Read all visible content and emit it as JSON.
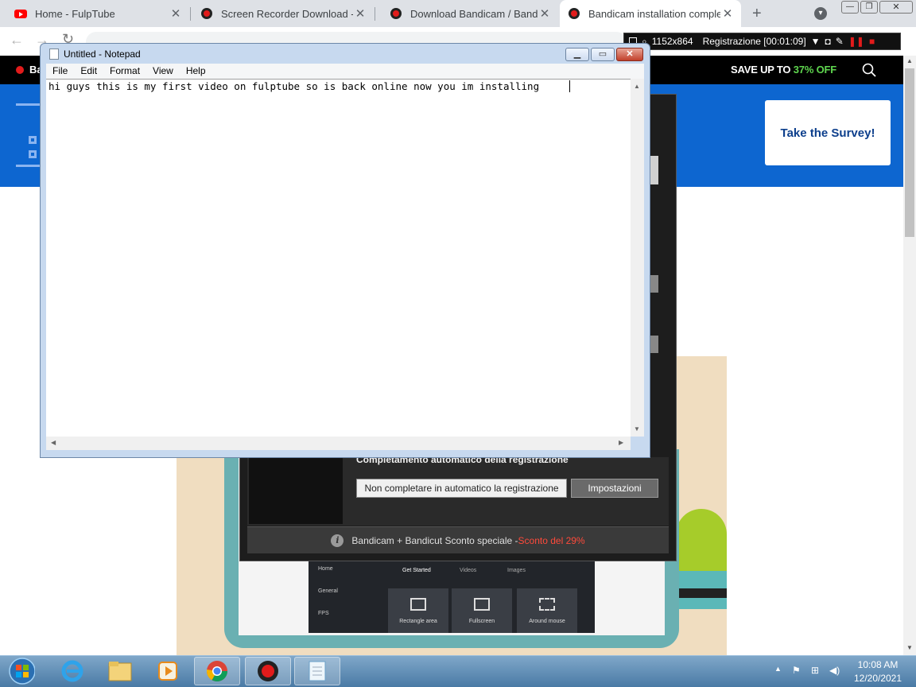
{
  "browser": {
    "tabs": [
      {
        "title": "Home - FulpTube",
        "favicon": "youtube-icon",
        "active": false
      },
      {
        "title": "Screen Recorder Download - Ba",
        "favicon": "bandicam-icon",
        "active": false
      },
      {
        "title": "Download Bandicam / Bandicut",
        "favicon": "bandicam-icon",
        "active": false
      },
      {
        "title": "Bandicam installation complete",
        "favicon": "bandicam-icon",
        "active": true
      }
    ],
    "new_tab_glyph": "+",
    "menu_glyph": "▾",
    "window_controls": {
      "minimize": "—",
      "restore": "❐",
      "close": "✕"
    }
  },
  "site": {
    "nav_brand": "Ba",
    "sale_prefix": "SAVE UP TO ",
    "sale_percent": "37% OFF",
    "survey_button": "Take the Survey!"
  },
  "recorder": {
    "resolution": "1152x864",
    "status": "Registrazione [00:01:09]"
  },
  "bandicam_dialog": {
    "section_title": "Completamento automatico della registrazione",
    "option_button": "Non completare in automatico la registrazione",
    "settings_button": "Impostazioni",
    "footer_text": "Bandicam + Bandicut Sconto speciale - ",
    "footer_discount": "Sconto del 29%"
  },
  "illustration": {
    "sidebar": [
      "Home",
      "General",
      "FPS"
    ],
    "tabs": [
      "Get Started",
      "Videos",
      "Images"
    ],
    "modes": [
      "Rectangle area",
      "Fullscreen",
      "Around mouse"
    ]
  },
  "notepad": {
    "title": "Untitled - Notepad",
    "menu": [
      "File",
      "Edit",
      "Format",
      "View",
      "Help"
    ],
    "content": "hi guys this is my first video on fulptube so is back online now you im installing"
  },
  "taskbar": {
    "time": "10:08 AM",
    "date": "12/20/2021",
    "pinned": [
      "start-orb-icon",
      "internet-explorer-icon",
      "file-explorer-icon",
      "media-player-icon",
      "chrome-icon",
      "bandicam-icon",
      "notepad-icon"
    ]
  },
  "colors": {
    "hero_blue": "#0d66d0",
    "sale_green": "#5fd64f",
    "discount_red": "#ff4a3a"
  }
}
